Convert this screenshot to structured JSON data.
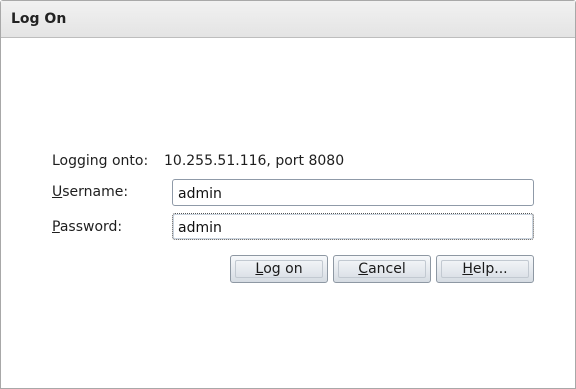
{
  "window": {
    "title": "Log On"
  },
  "logon": {
    "logging_label": "Logging onto:",
    "server": "10.255.51.116, port 8080",
    "username_mnemonic": "U",
    "username_rest": "sername:",
    "username_value": "admin",
    "password_mnemonic": "P",
    "password_rest": "assword:",
    "password_value": "admin"
  },
  "buttons": {
    "logon_pre": "",
    "logon_mnemonic": "L",
    "logon_rest": "og on",
    "cancel_pre": "",
    "cancel_mnemonic": "C",
    "cancel_rest": "ancel",
    "help_pre": "",
    "help_mnemonic": "H",
    "help_rest": "elp..."
  }
}
